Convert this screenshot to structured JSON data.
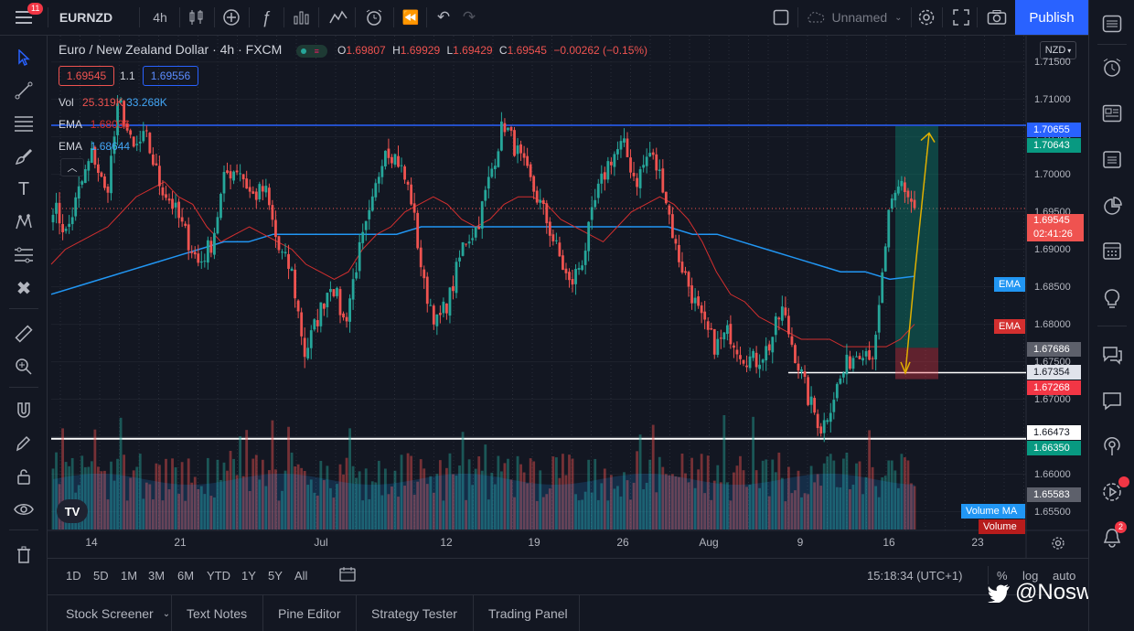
{
  "topbar": {
    "notifications": "11",
    "symbol": "EURNZD",
    "interval": "4h",
    "layout_name": "Unnamed",
    "publish_label": "Publish"
  },
  "legend": {
    "title": "Euro / New Zealand Dollar · 4h · FXCM",
    "o_label": "O",
    "o_value": "1.69807",
    "h_label": "H",
    "h_value": "1.69929",
    "l_label": "L",
    "l_value": "1.69429",
    "c_label": "C",
    "c_value": "1.69545",
    "change": "−0.00262 (−0.15%)",
    "bid": "1.69545",
    "spread": "1.1",
    "ask": "1.69556",
    "vol_label": "Vol",
    "vol_a": "25.319K",
    "vol_b": "33.268K",
    "ema1_label": "EMA",
    "ema1_value": "1.68036",
    "ema2_label": "EMA",
    "ema2_value": "1.68644"
  },
  "price_axis": {
    "currency": "NZD",
    "ticks": [
      "1.71500",
      "1.71000",
      "1.70500",
      "1.70000",
      "1.69500",
      "1.69000",
      "1.68500",
      "1.68000",
      "1.67500",
      "1.67000",
      "1.66500",
      "1.66000",
      "1.65500"
    ],
    "labels": {
      "line_top_blue": "1.70655",
      "target_green": "1.70643",
      "current": "1.69545",
      "countdown": "02:41:26",
      "ema_blue": "EMA",
      "ema_red": "EMA",
      "entry_grey": "1.67686",
      "line_white_mid": "1.67354",
      "stop_red": "1.67268",
      "line_white_low": "1.66473",
      "green_low": "1.66350",
      "grey_low": "1.65583",
      "volume_ma": "Volume MA",
      "volume": "Volume"
    }
  },
  "time_axis": {
    "ticks": [
      "14",
      "21",
      "Jul",
      "12",
      "19",
      "26",
      "Aug",
      "9",
      "16",
      "23"
    ]
  },
  "range_bar": {
    "ranges": [
      "1D",
      "5D",
      "1M",
      "3M",
      "6M",
      "YTD",
      "1Y",
      "5Y",
      "All"
    ],
    "clock": "15:18:34 (UTC+1)",
    "percent": "%",
    "log": "log",
    "auto": "auto"
  },
  "bottom_tabs": [
    "Stock Screener",
    "Text Notes",
    "Pine Editor",
    "Strategy Tester",
    "Trading Panel"
  ],
  "watermark": "@Noswus",
  "right_sidebar": {
    "badge_notifications": "2"
  },
  "colors": {
    "up": "#26a69a",
    "down": "#ef5350",
    "ema_fast": "#d32f2f",
    "ema_slow": "#2196f3",
    "accent": "#2962ff"
  },
  "chart_data": {
    "type": "candlestick",
    "symbol": "EURNZD",
    "timeframe": "4h",
    "ylim": [
      1.6525,
      1.7185
    ],
    "horizontal_lines": [
      1.70655,
      1.67354,
      1.66473
    ],
    "position": {
      "entry": 1.67686,
      "target": 1.70643,
      "stop": 1.67268
    },
    "close_path": [
      1.696,
      1.692,
      1.698,
      1.703,
      1.697,
      1.71,
      1.703,
      1.705,
      1.699,
      1.696,
      1.692,
      1.688,
      1.691,
      1.7,
      1.701,
      1.697,
      1.698,
      1.69,
      1.687,
      1.676,
      1.681,
      1.686,
      1.68,
      1.689,
      1.695,
      1.704,
      1.702,
      1.697,
      1.685,
      1.68,
      1.684,
      1.691,
      1.693,
      1.7,
      1.707,
      1.703,
      1.699,
      1.695,
      1.69,
      1.685,
      1.689,
      1.697,
      1.702,
      1.704,
      1.699,
      1.703,
      1.699,
      1.69,
      1.685,
      1.68,
      1.677,
      1.679,
      1.676,
      1.675,
      1.677,
      1.682,
      1.676,
      1.67,
      1.666,
      1.671,
      1.675,
      1.677,
      1.676,
      1.694,
      1.699,
      1.6955
    ],
    "ema_fast": [
      1.688,
      1.69,
      1.691,
      1.692,
      1.693,
      1.695,
      1.697,
      1.698,
      1.699,
      1.697,
      1.696,
      1.693,
      1.691,
      1.692,
      1.693,
      1.692,
      1.691,
      1.69,
      1.688,
      1.687,
      1.686,
      1.687,
      1.69,
      1.692,
      1.693,
      1.695,
      1.696,
      1.697,
      1.696,
      1.694,
      1.693,
      1.694,
      1.696,
      1.697,
      1.697,
      1.696,
      1.694,
      1.693,
      1.692,
      1.691,
      1.693,
      1.695,
      1.696,
      1.697,
      1.696,
      1.694,
      1.691,
      1.687,
      1.684,
      1.683,
      1.681,
      1.68,
      1.679,
      1.678,
      1.678,
      1.678,
      1.677,
      1.677,
      1.677,
      1.677,
      1.678,
      1.68
    ],
    "ema_slow": [
      1.684,
      1.685,
      1.686,
      1.687,
      1.688,
      1.689,
      1.69,
      1.691,
      1.691,
      1.692,
      1.692,
      1.692,
      1.692,
      1.692,
      1.692,
      1.693,
      1.693,
      1.693,
      1.693,
      1.693,
      1.693,
      1.693,
      1.693,
      1.693,
      1.693,
      1.693,
      1.692,
      1.692,
      1.691,
      1.69,
      1.689,
      1.688,
      1.687,
      1.687,
      1.686,
      1.6864
    ]
  }
}
